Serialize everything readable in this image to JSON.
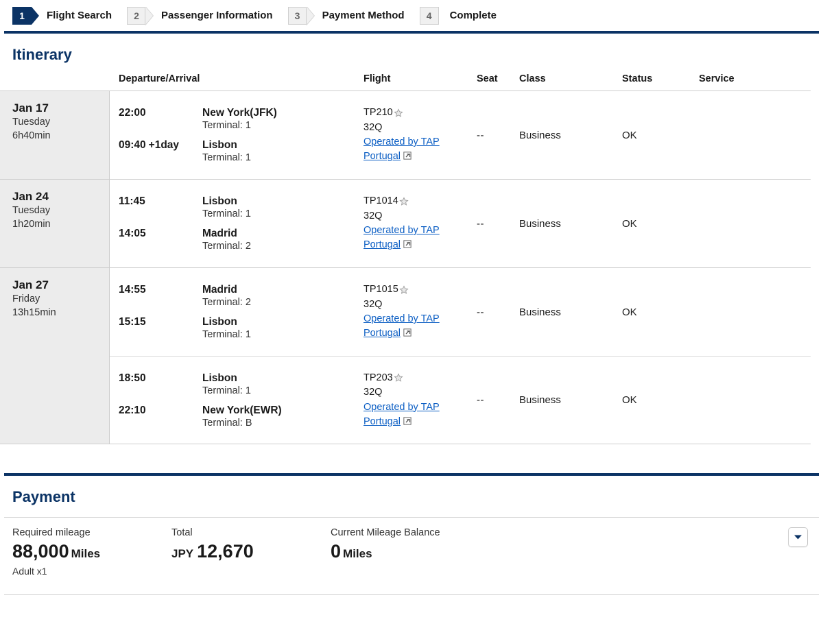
{
  "colors": {
    "brand_navy": "#0b3365",
    "link_blue": "#0d5fc4",
    "row_date_bg": "#ececec",
    "border_gray": "#cccccc"
  },
  "steps": [
    {
      "number": "1",
      "label": "Flight Search",
      "state": "active"
    },
    {
      "number": "2",
      "label": "Passenger Information",
      "state": "inactive"
    },
    {
      "number": "3",
      "label": "Payment Method",
      "state": "inactive"
    },
    {
      "number": "4",
      "label": "Complete",
      "state": "inactive"
    }
  ],
  "itinerary": {
    "title": "Itinerary",
    "columns": {
      "date": "",
      "departure_arrival": "Departure/Arrival",
      "flight": "Flight",
      "seat": "Seat",
      "class": "Class",
      "status": "Status",
      "service": "Service"
    },
    "rows": [
      {
        "date": "Jan 17",
        "weekday": "Tuesday",
        "duration": "6h40min",
        "segments": [
          {
            "dep_time": "22:00",
            "dep_plusday": "",
            "dep_city": "New York(JFK)",
            "dep_terminal": "Terminal: 1",
            "arr_time": "09:40",
            "arr_plusday": "+1day",
            "arr_city": "Lisbon",
            "arr_terminal": "Terminal: 1",
            "flight_no": "TP210",
            "aircraft": "32Q",
            "operated_by": "Operated by TAP Portugal",
            "seat": "--",
            "class": "Business",
            "status": "OK",
            "service": ""
          }
        ]
      },
      {
        "date": "Jan 24",
        "weekday": "Tuesday",
        "duration": "1h20min",
        "segments": [
          {
            "dep_time": "11:45",
            "dep_plusday": "",
            "dep_city": "Lisbon",
            "dep_terminal": "Terminal: 1",
            "arr_time": "14:05",
            "arr_plusday": "",
            "arr_city": "Madrid",
            "arr_terminal": "Terminal: 2",
            "flight_no": "TP1014",
            "aircraft": "32Q",
            "operated_by": "Operated by TAP Portugal",
            "seat": "--",
            "class": "Business",
            "status": "OK",
            "service": ""
          }
        ]
      },
      {
        "date": "Jan 27",
        "weekday": "Friday",
        "duration": "13h15min",
        "segments": [
          {
            "dep_time": "14:55",
            "dep_plusday": "",
            "dep_city": "Madrid",
            "dep_terminal": "Terminal: 2",
            "arr_time": "15:15",
            "arr_plusday": "",
            "arr_city": "Lisbon",
            "arr_terminal": "Terminal: 1",
            "flight_no": "TP1015",
            "aircraft": "32Q",
            "operated_by": "Operated by TAP Portugal",
            "seat": "--",
            "class": "Business",
            "status": "OK",
            "service": ""
          },
          {
            "dep_time": "18:50",
            "dep_plusday": "",
            "dep_city": "Lisbon",
            "dep_terminal": "Terminal: 1",
            "arr_time": "22:10",
            "arr_plusday": "",
            "arr_city": "New York(EWR)",
            "arr_terminal": "Terminal: B",
            "flight_no": "TP203",
            "aircraft": "32Q",
            "operated_by": "Operated by TAP Portugal",
            "seat": "--",
            "class": "Business",
            "status": "OK",
            "service": ""
          }
        ]
      }
    ]
  },
  "payment": {
    "title": "Payment",
    "required_mileage_label": "Required mileage",
    "required_mileage_value": "88,000",
    "required_mileage_unit": "Miles",
    "passenger_note": "Adult x1",
    "total_label": "Total",
    "total_currency": "JPY",
    "total_value": "12,670",
    "balance_label": "Current Mileage Balance",
    "balance_value": "0",
    "balance_unit": "Miles"
  },
  "icons": {
    "star": "star-icon",
    "external_link": "external-link-icon",
    "expand": "chevron-down-icon"
  }
}
